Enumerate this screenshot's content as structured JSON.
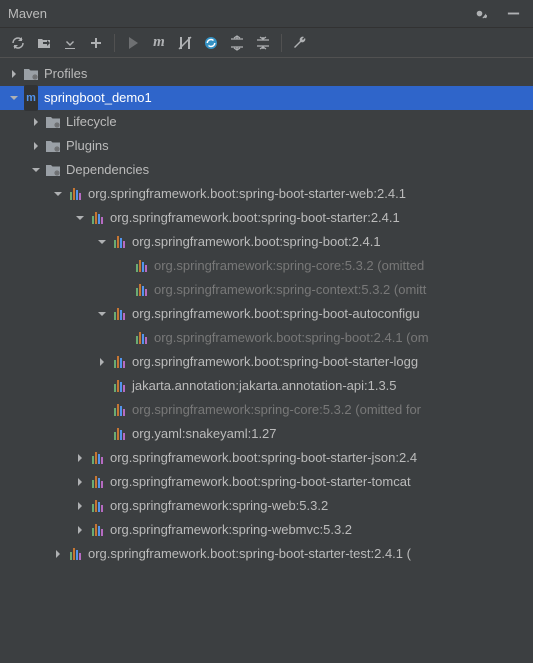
{
  "title": "Maven",
  "toolbar": {
    "icons": [
      "refresh",
      "link",
      "download",
      "add",
      "sep",
      "run",
      "m",
      "skip",
      "update",
      "expand",
      "collapse",
      "sep",
      "wrench"
    ]
  },
  "tree": [
    {
      "depth": 0,
      "arrow": "closed",
      "icon": "folder-gear",
      "label": "Profiles",
      "name": "profiles-node"
    },
    {
      "depth": 0,
      "arrow": "open",
      "icon": "maven",
      "label": "springboot_demo1",
      "name": "project-node",
      "selected": true
    },
    {
      "depth": 1,
      "arrow": "closed",
      "icon": "folder-gear",
      "label": "Lifecycle",
      "name": "lifecycle-node"
    },
    {
      "depth": 1,
      "arrow": "closed",
      "icon": "folder-gear",
      "label": "Plugins",
      "name": "plugins-node"
    },
    {
      "depth": 1,
      "arrow": "open",
      "icon": "folder-gear",
      "label": "Dependencies",
      "name": "dependencies-node"
    },
    {
      "depth": 2,
      "arrow": "open",
      "icon": "lib",
      "label": "org.springframework.boot:spring-boot-starter-web:2.4.1",
      "name": "dep-node"
    },
    {
      "depth": 3,
      "arrow": "open",
      "icon": "lib",
      "label": "org.springframework.boot:spring-boot-starter:2.4.1",
      "name": "dep-node"
    },
    {
      "depth": 4,
      "arrow": "open",
      "icon": "lib",
      "label": "org.springframework.boot:spring-boot:2.4.1",
      "name": "dep-node"
    },
    {
      "depth": 5,
      "arrow": "none",
      "icon": "lib",
      "label": "org.springframework:spring-core:5.3.2 (omitted ",
      "name": "dep-node",
      "dim": true
    },
    {
      "depth": 5,
      "arrow": "none",
      "icon": "lib",
      "label": "org.springframework:spring-context:5.3.2 (omitt",
      "name": "dep-node",
      "dim": true
    },
    {
      "depth": 4,
      "arrow": "open",
      "icon": "lib",
      "label": "org.springframework.boot:spring-boot-autoconfigu",
      "name": "dep-node"
    },
    {
      "depth": 5,
      "arrow": "none",
      "icon": "lib",
      "label": "org.springframework.boot:spring-boot:2.4.1 (om",
      "name": "dep-node",
      "dim": true
    },
    {
      "depth": 4,
      "arrow": "closed",
      "icon": "lib",
      "label": "org.springframework.boot:spring-boot-starter-logg",
      "name": "dep-node"
    },
    {
      "depth": 4,
      "arrow": "none",
      "icon": "lib",
      "label": "jakarta.annotation:jakarta.annotation-api:1.3.5",
      "name": "dep-node"
    },
    {
      "depth": 4,
      "arrow": "none",
      "icon": "lib",
      "label": "org.springframework:spring-core:5.3.2 (omitted for",
      "name": "dep-node",
      "dim": true
    },
    {
      "depth": 4,
      "arrow": "none",
      "icon": "lib",
      "label": "org.yaml:snakeyaml:1.27",
      "name": "dep-node"
    },
    {
      "depth": 3,
      "arrow": "closed",
      "icon": "lib",
      "label": "org.springframework.boot:spring-boot-starter-json:2.4",
      "name": "dep-node"
    },
    {
      "depth": 3,
      "arrow": "closed",
      "icon": "lib",
      "label": "org.springframework.boot:spring-boot-starter-tomcat",
      "name": "dep-node"
    },
    {
      "depth": 3,
      "arrow": "closed",
      "icon": "lib",
      "label": "org.springframework:spring-web:5.3.2",
      "name": "dep-node"
    },
    {
      "depth": 3,
      "arrow": "closed",
      "icon": "lib",
      "label": "org.springframework:spring-webmvc:5.3.2",
      "name": "dep-node"
    },
    {
      "depth": 2,
      "arrow": "closed",
      "icon": "lib",
      "label": "org.springframework.boot:spring-boot-starter-test:2.4.1 (",
      "name": "dep-node"
    }
  ]
}
